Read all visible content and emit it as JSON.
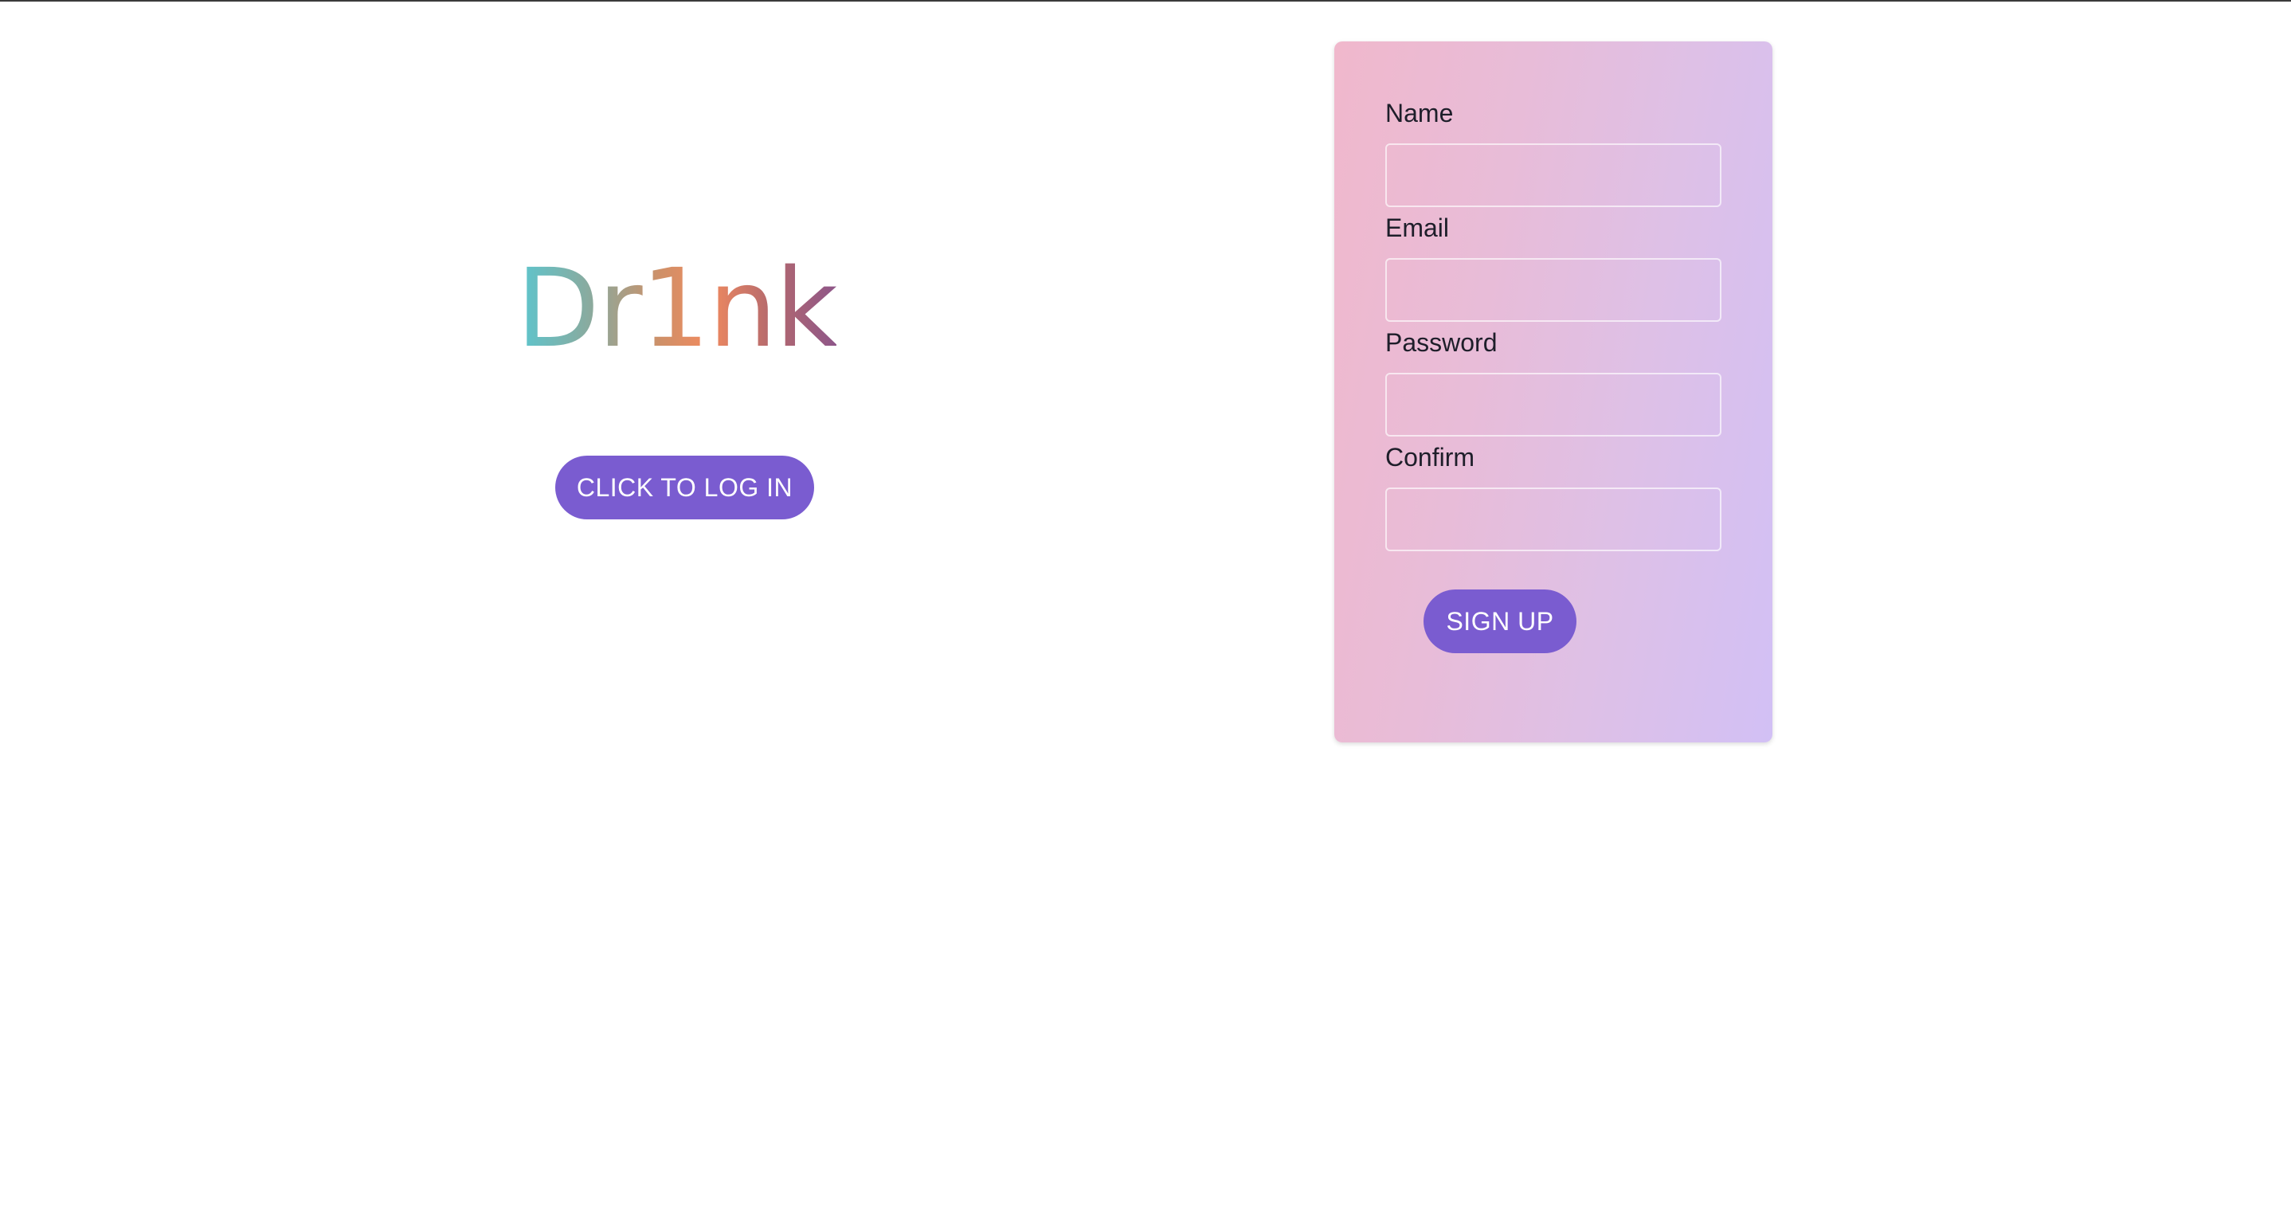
{
  "brand": {
    "logo_text": "Dr1nk"
  },
  "login": {
    "button_label": "CLICK TO LOG IN"
  },
  "signup_form": {
    "fields": [
      {
        "label": "Name",
        "value": "",
        "placeholder": ""
      },
      {
        "label": "Email",
        "value": "",
        "placeholder": ""
      },
      {
        "label": "Password",
        "value": "",
        "placeholder": ""
      },
      {
        "label": "Confirm",
        "value": "",
        "placeholder": ""
      }
    ],
    "submit_label": "SIGN UP"
  },
  "colors": {
    "accent": "#7a5cd0",
    "card_gradient_start": "#f0b8cc",
    "card_gradient_end": "#d2c0f5",
    "logo_gradient": [
      "#5bc6cf",
      "#cf9068",
      "#f08a5f",
      "#8e5689"
    ]
  }
}
